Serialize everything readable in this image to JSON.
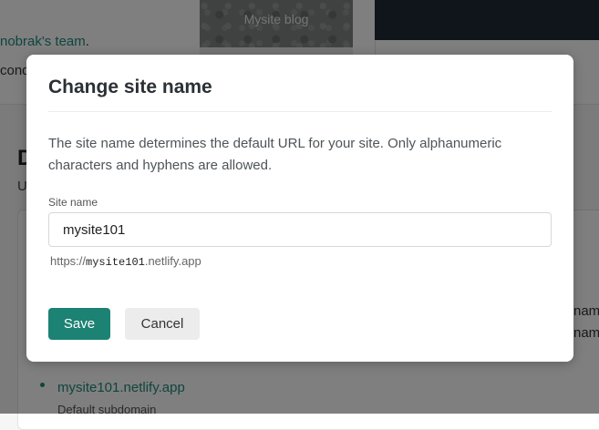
{
  "background": {
    "team_line_link": "nobrak's team",
    "team_line_suffix": ".",
    "second_line_fragment": "cond",
    "thumbnail_label": "Mysite blog",
    "section_heading_fragment": "D",
    "section_sub_fragment": "U",
    "right_text_1": "nam",
    "right_text_2": "nam",
    "default_domain": "mysite101.netlify.app",
    "default_domain_note": "Default subdomain"
  },
  "modal": {
    "title": "Change site name",
    "description": "The site name determines the default URL for your site. Only alphanumeric characters and hyphens are allowed.",
    "field_label": "Site name",
    "field_value": "mysite101",
    "url_prefix": "https://",
    "url_site": "mysite101",
    "url_suffix": ".netlify.app",
    "save_label": "Save",
    "cancel_label": "Cancel"
  },
  "colors": {
    "accent": "#1c8273",
    "link": "#1f8a7a",
    "overlay": "rgba(0,0,0,0.5)"
  }
}
